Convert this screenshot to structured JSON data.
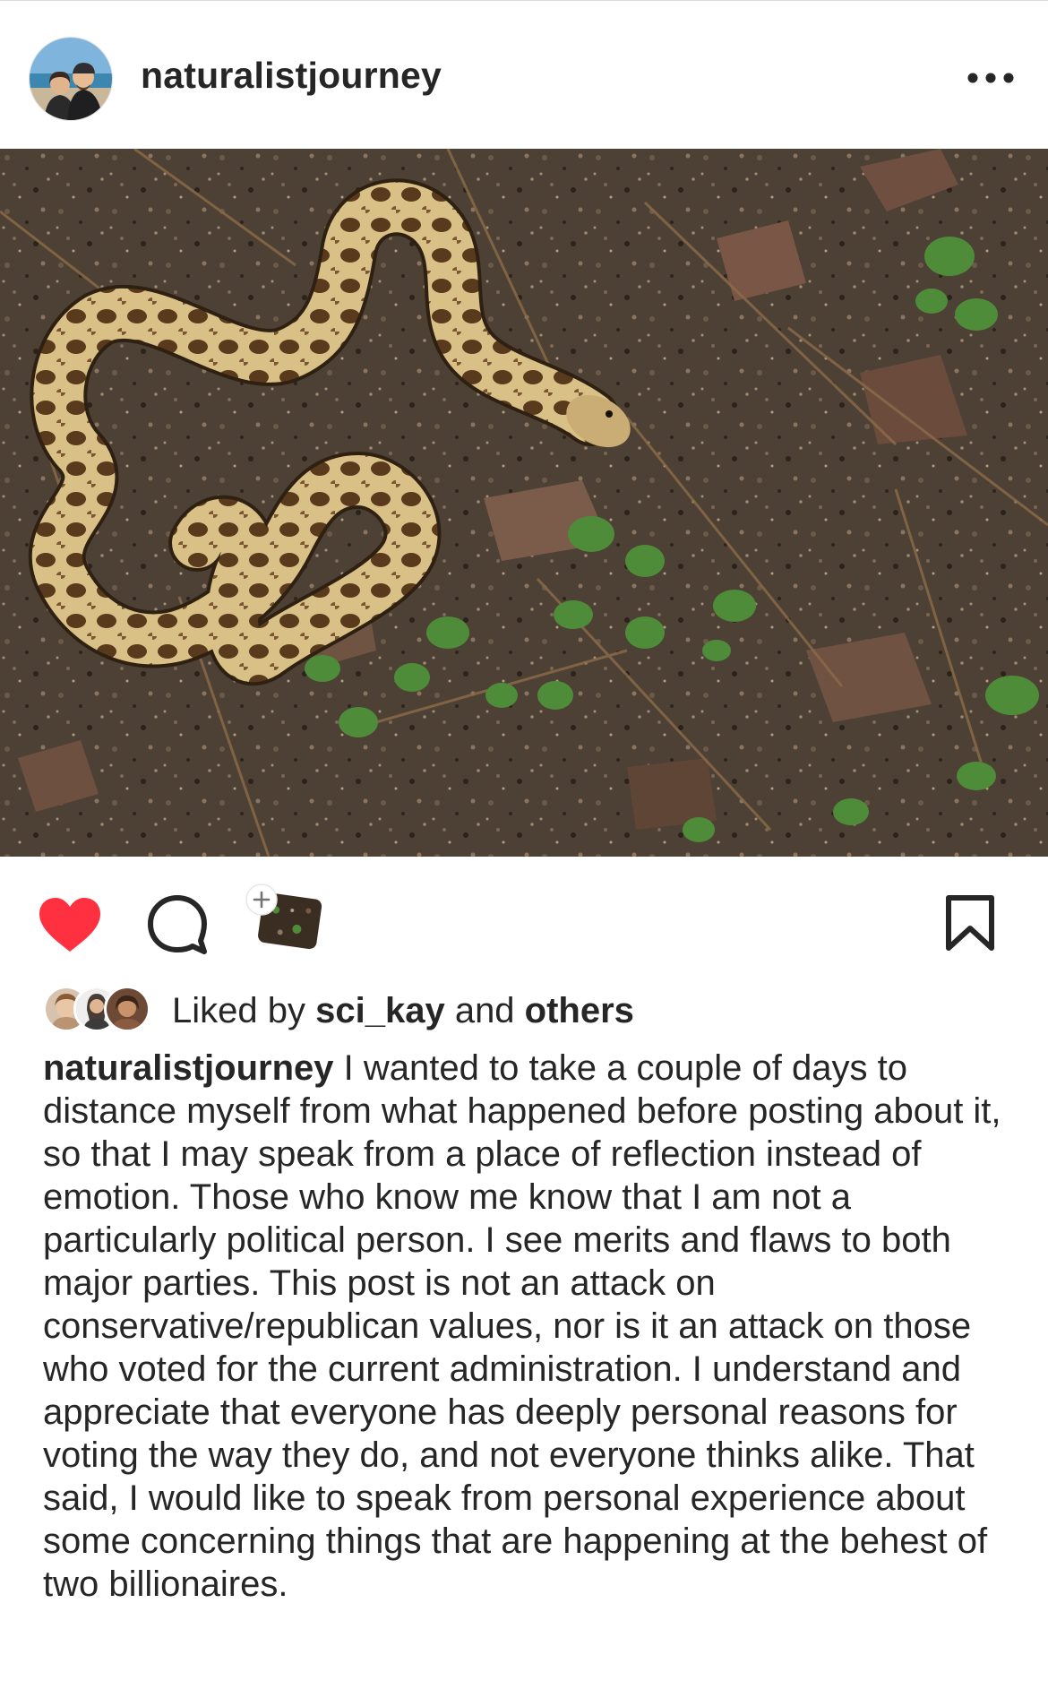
{
  "post": {
    "username": "naturalistjourney",
    "more_icon": "ellipsis-horizontal-icon",
    "photo_alt": "Snake coiled on forest floor among pine needles and small green leaves"
  },
  "actions": {
    "like_icon": "heart-filled-icon",
    "like_color": "#ff3040",
    "comment_icon": "comment-bubble-icon",
    "share_icon": "add-to-story-icon",
    "save_icon": "bookmark-icon"
  },
  "likes": {
    "prefix": "Liked by ",
    "user": "sci_kay",
    "joiner": " and ",
    "others": "others"
  },
  "caption": {
    "username": "naturalistjourney",
    "text": "I wanted to take a couple of days to distance myself from what happened before posting about it, so that I may speak from a place of reflection instead of emotion. Those who know me know that I am not a particularly political person. I see merits and flaws to both major parties. This post is not an attack on conservative/republican values, nor is it an attack on those who voted for the current administration. I understand and appreciate that everyone has deeply personal reasons for voting the way they do, and not everyone thinks alike. That said, I would like to speak from personal experience about some concerning things that are happening at the behest of two billionaires."
  }
}
